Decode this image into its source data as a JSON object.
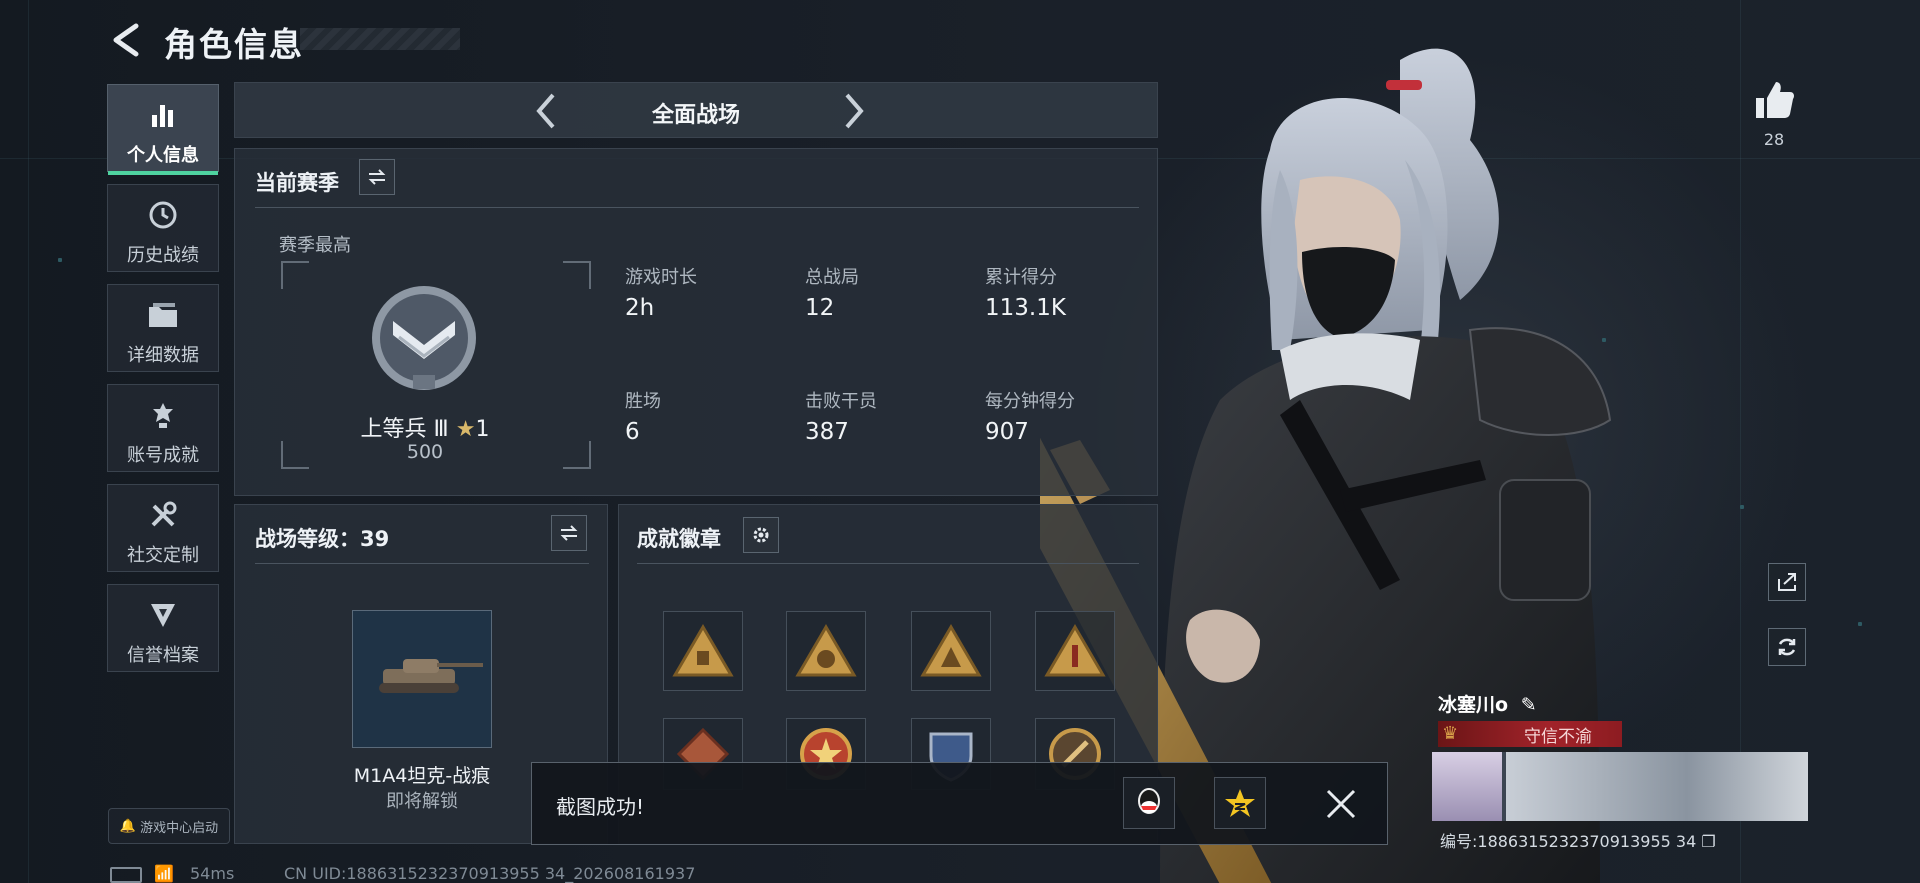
{
  "header": {
    "title": "角色信息"
  },
  "sidebar": {
    "items": [
      {
        "label": "个人信息",
        "icon": "bar-chart-icon",
        "active": true
      },
      {
        "label": "历史战绩",
        "icon": "clock-icon"
      },
      {
        "label": "详细数据",
        "icon": "folder-icon"
      },
      {
        "label": "账号成就",
        "icon": "achievement-icon"
      },
      {
        "label": "社交定制",
        "icon": "tools-icon"
      },
      {
        "label": "信誉档案",
        "icon": "reputation-icon"
      }
    ],
    "launch_label": "游戏中心启动"
  },
  "mode_bar": {
    "title": "全面战场"
  },
  "season": {
    "title": "当前赛季",
    "best_label": "赛季最高",
    "rank_name": "上等兵 Ⅲ",
    "rank_stars": "1",
    "rank_points": "500",
    "stats": [
      {
        "label": "游戏时长",
        "value": "2h"
      },
      {
        "label": "总战局",
        "value": "12"
      },
      {
        "label": "累计得分",
        "value": "113.1K"
      },
      {
        "label": "胜场",
        "value": "6"
      },
      {
        "label": "击败干员",
        "value": "387"
      },
      {
        "label": "每分钟得分",
        "value": "907"
      }
    ]
  },
  "battlefield_level": {
    "title": "战场等级：39",
    "vehicle_name": "M1A4坦克-战痕",
    "vehicle_status": "即将解锁"
  },
  "badges": {
    "title": "成就徽章",
    "count": 8
  },
  "right_hud": {
    "like_count": "28"
  },
  "player": {
    "name": "冰塞川o",
    "title": "守信不渝",
    "id_code": "编号:1886315232370913955 34"
  },
  "status": {
    "ping": "54ms",
    "uid": "CN UID:1886315232370913955 34_202608161937"
  },
  "toast": {
    "message": "截图成功!"
  },
  "colors": {
    "accent": "#4fd3a0",
    "title_tag": "#a2232a",
    "bg": "#161c24"
  }
}
